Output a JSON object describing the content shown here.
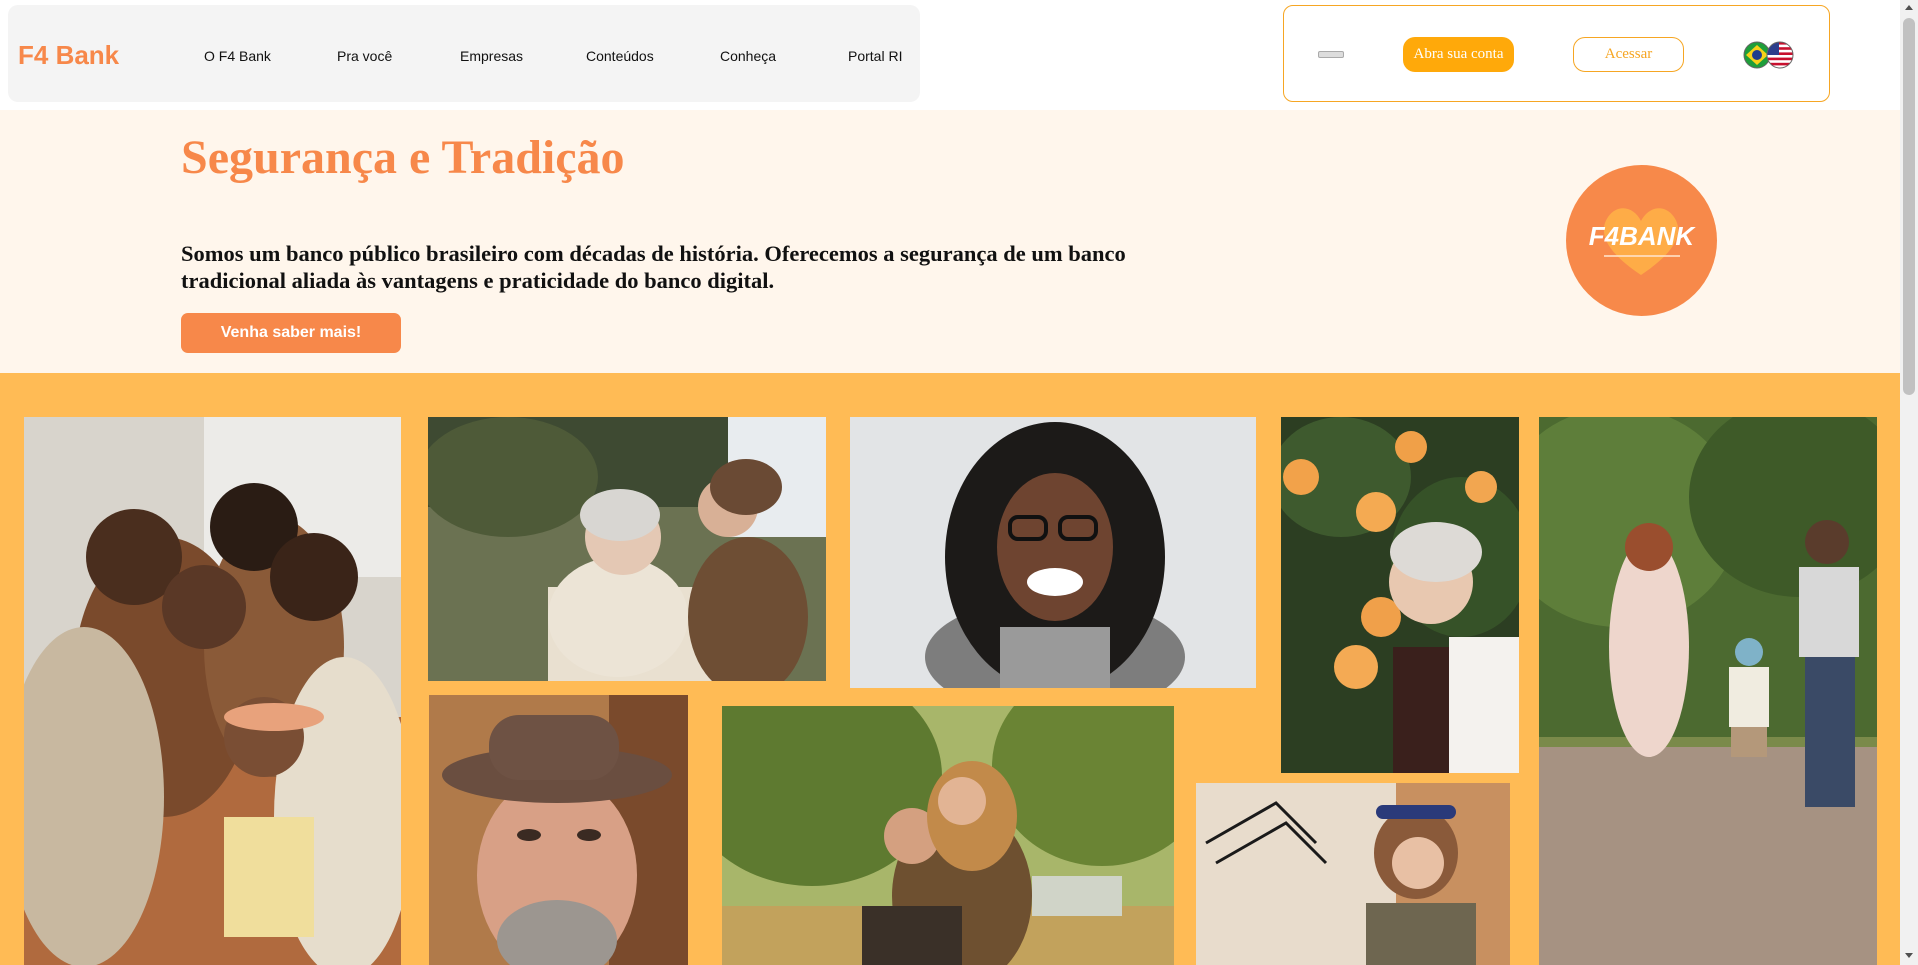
{
  "header": {
    "logo": "F4 Bank",
    "nav": [
      "O F4 Bank",
      "Pra você",
      "Empresas",
      "Conteúdos",
      "Conheça",
      "Portal RI"
    ],
    "open_account": "Abra sua conta",
    "access": "Acessar",
    "flags": [
      "brazil-flag-icon",
      "usa-flag-icon"
    ]
  },
  "hero": {
    "title": "Segurança e Tradição",
    "text": "Somos um banco público brasileiro com décadas de história. Oferecemos a segurança de um banco tradicional aliada às vantagens e praticidade do banco digital.",
    "cta": "Venha saber mais!",
    "badge_logo": "F4BANK"
  },
  "gallery": {
    "photos": [
      "family-hug-photo",
      "elderly-woman-with-daughter-photo",
      "smiling-woman-glasses-photo",
      "elderly-woman-flowers-photo",
      "family-walking-photo",
      "man-with-hat-photo",
      "couple-piggyback-photo",
      "woman-working-photo"
    ]
  },
  "colors": {
    "brand_orange": "#f7884a",
    "accent_yellow": "#ffa90a",
    "hero_bg": "#fff6ec",
    "gallery_bg": "#ffbb55"
  }
}
